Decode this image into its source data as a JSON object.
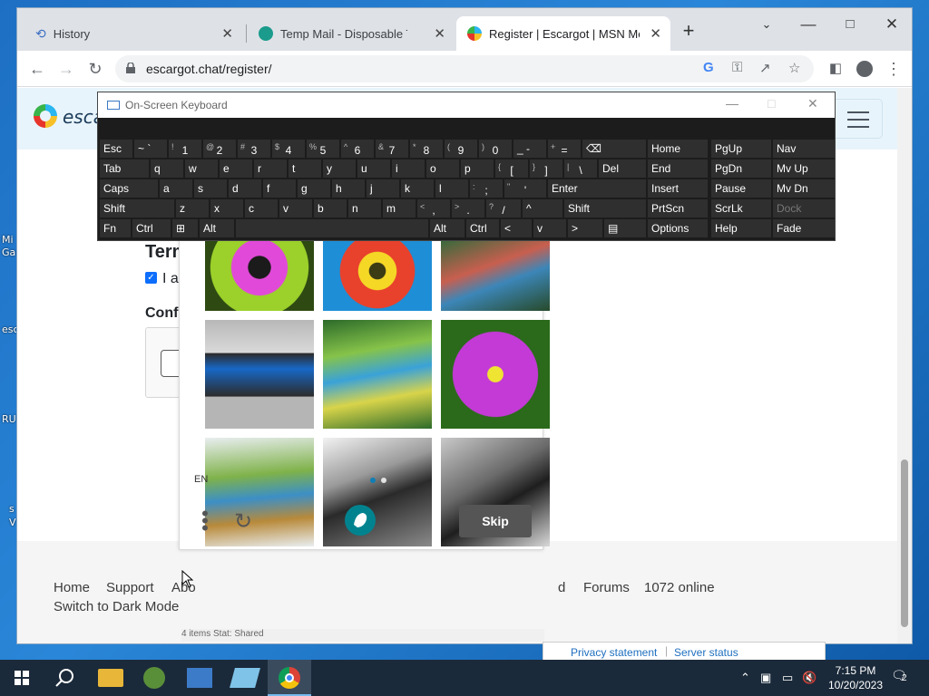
{
  "desktop": {
    "labels": [
      "Mi",
      "Ga",
      "esc",
      "RU",
      "s",
      "V"
    ]
  },
  "browser": {
    "tabs": [
      {
        "title": "History",
        "icon": "history-icon"
      },
      {
        "title": "Temp Mail - Disposable Tempor",
        "icon": "tempmail-favicon"
      },
      {
        "title": "Register | Escargot | MSN Messe",
        "icon": "escargot-favicon"
      }
    ],
    "new_tab": "+",
    "url": "escargot.chat/register/"
  },
  "site": {
    "logo_text": "escar",
    "terms_heading": "Terms",
    "agree_text": "I agre",
    "confirm_heading": "Confirm"
  },
  "footer": {
    "links": [
      "Home",
      "Support",
      "Abo",
      "d",
      "Forums",
      "1072 online"
    ],
    "dark_mode": "Switch to Dark Mode",
    "privacy": "Privacy statement",
    "server_status": "Server status",
    "behind_status": "4 items    Stat:    Shared"
  },
  "hcaptcha": {
    "language": "EN",
    "skip": "Skip",
    "page_dots": 2,
    "active_page": 1
  },
  "osk": {
    "title": "On-Screen Keyboard",
    "row1": [
      {
        "main": "Esc"
      },
      {
        "main": "~ `"
      },
      {
        "sub": "!",
        "main": "1"
      },
      {
        "sub": "@",
        "main": "2"
      },
      {
        "sub": "#",
        "main": "3"
      },
      {
        "sub": "$",
        "main": "4"
      },
      {
        "sub": "%",
        "main": "5"
      },
      {
        "sub": "^",
        "main": "6"
      },
      {
        "sub": "&",
        "main": "7"
      },
      {
        "sub": "*",
        "main": "8"
      },
      {
        "sub": "(",
        "main": "9"
      },
      {
        "sub": ")",
        "main": "0"
      },
      {
        "main": "_ -"
      },
      {
        "sub": "+",
        "main": "="
      },
      {
        "main": "⌫"
      }
    ],
    "row2": [
      {
        "main": "Tab"
      },
      {
        "main": "q"
      },
      {
        "main": "w"
      },
      {
        "main": "e"
      },
      {
        "main": "r"
      },
      {
        "main": "t"
      },
      {
        "main": "y"
      },
      {
        "main": "u"
      },
      {
        "main": "i"
      },
      {
        "main": "o"
      },
      {
        "main": "p"
      },
      {
        "sub": "{",
        "main": "["
      },
      {
        "sub": "}",
        "main": "]"
      },
      {
        "sub": "|",
        "main": "\\"
      },
      {
        "main": "Del"
      }
    ],
    "row3": [
      {
        "main": "Caps"
      },
      {
        "main": "a"
      },
      {
        "main": "s"
      },
      {
        "main": "d"
      },
      {
        "main": "f"
      },
      {
        "main": "g"
      },
      {
        "main": "h"
      },
      {
        "main": "j"
      },
      {
        "main": "k"
      },
      {
        "main": "l"
      },
      {
        "sub": ":",
        "main": ";"
      },
      {
        "sub": "\"",
        "main": "'"
      },
      {
        "main": "Enter"
      }
    ],
    "row4": [
      {
        "main": "Shift"
      },
      {
        "main": "z"
      },
      {
        "main": "x"
      },
      {
        "main": "c"
      },
      {
        "main": "v"
      },
      {
        "main": "b"
      },
      {
        "main": "n"
      },
      {
        "main": "m"
      },
      {
        "sub": "<",
        "main": ","
      },
      {
        "sub": ">",
        "main": "."
      },
      {
        "sub": "?",
        "main": "/"
      },
      {
        "main": "^"
      },
      {
        "main": "Shift"
      }
    ],
    "row5": [
      {
        "main": "Fn"
      },
      {
        "main": "Ctrl"
      },
      {
        "main": "⊞"
      },
      {
        "main": "Alt"
      },
      {
        "main": ""
      },
      {
        "main": "Alt"
      },
      {
        "main": "Ctrl"
      },
      {
        "main": "<"
      },
      {
        "main": "v"
      },
      {
        "main": ">"
      },
      {
        "main": "▤"
      }
    ],
    "nav": [
      [
        "Home",
        "PgUp",
        "Nav"
      ],
      [
        "End",
        "PgDn",
        "Mv Up"
      ],
      [
        "Insert",
        "Pause",
        "Mv Dn"
      ],
      [
        "PrtScn",
        "ScrLk",
        "Dock"
      ],
      [
        "Options",
        "Help",
        "Fade"
      ]
    ]
  },
  "taskbar": {
    "time": "7:15 PM",
    "date": "10/20/2023",
    "notifications": "2"
  }
}
